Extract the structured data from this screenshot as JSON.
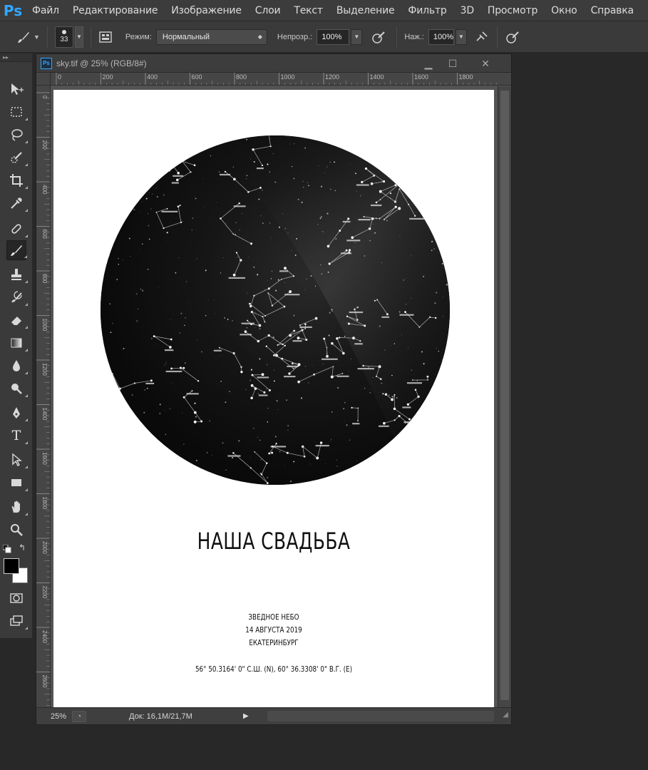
{
  "app": {
    "logo": "Ps",
    "menu": [
      "Файл",
      "Редактирование",
      "Изображение",
      "Слои",
      "Текст",
      "Выделение",
      "Фильтр",
      "3D",
      "Просмотр",
      "Окно",
      "Справка"
    ]
  },
  "options": {
    "brush_size": "33",
    "mode_label": "Режим:",
    "mode_value": "Нормальный",
    "opacity_label": "Непрозр.:",
    "opacity_value": "100%",
    "flow_label": "Наж.:",
    "flow_value": "100%"
  },
  "document": {
    "tab_title": "sky.tif @ 25% (RGB/8#)",
    "ruler_h_labels": [
      "0",
      "200",
      "400",
      "600",
      "800",
      "1000",
      "1200",
      "1400",
      "1600",
      "1800"
    ],
    "ruler_v_labels": [
      "0",
      "200",
      "400",
      "600",
      "800",
      "1000",
      "1200",
      "1400",
      "1600",
      "1800",
      "2000",
      "2200",
      "2400",
      "2600"
    ],
    "zoom": "25%",
    "doc_size": "Док: 16,1M/21,7M"
  },
  "poster": {
    "title": "НАША СВАДЬБА",
    "line1": "ЗВЕДНОЕ НЕБО",
    "line2": "14 АВГУСТА 2019",
    "line3": "ЕКАТЕРИНБУРГ",
    "coords": "56° 50.3164' 0\" С.Ш. (N), 60° 36.3308' 0\" В.Г. (E)"
  },
  "colors": {
    "foreground": "#000000",
    "background": "#ffffff",
    "ps_blue": "#31a8ff"
  }
}
